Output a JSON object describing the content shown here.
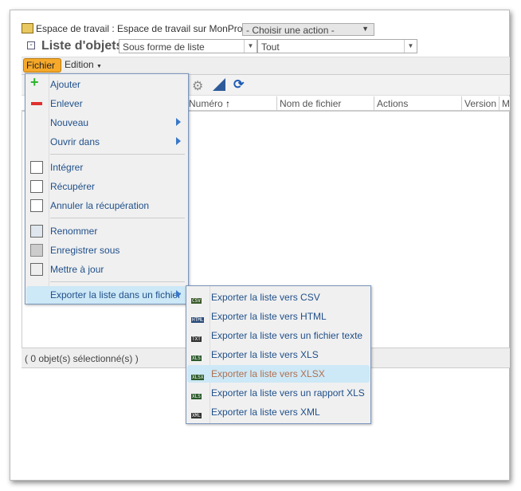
{
  "header": {
    "workspace": "Espace de travail : Espace de travail sur MonProduit",
    "action_select": "- Choisir une action -",
    "title": "Liste d'objets",
    "view_select": "Sous forme de liste",
    "filter_select": "Tout"
  },
  "menubar": {
    "file": "Fichier",
    "edit": "Edition"
  },
  "table": {
    "columns": [
      "Numéro",
      "Nom de fichier",
      "Actions",
      "Version",
      "M"
    ],
    "sort_indicator": "↑"
  },
  "status": "( 0 objet(s) sélectionné(s) )",
  "file_menu": {
    "items": [
      {
        "label": "Ajouter",
        "icon": "add-icon"
      },
      {
        "label": "Enlever",
        "icon": "remove-icon"
      },
      {
        "label": "Nouveau",
        "submenu": true
      },
      {
        "label": "Ouvrir dans",
        "submenu": true
      },
      {
        "label": "Intégrer",
        "icon": "checkin-icon"
      },
      {
        "label": "Récupérer",
        "icon": "checkout-icon"
      },
      {
        "label": "Annuler la récupération",
        "icon": "undo-checkout-icon"
      },
      {
        "label": "Renommer",
        "icon": "rename-icon"
      },
      {
        "label": "Enregistrer sous",
        "icon": "save-as-icon"
      },
      {
        "label": "Mettre à jour",
        "icon": "update-icon"
      },
      {
        "label": "Exporter la liste dans un fichier",
        "submenu": true,
        "highlighted": true
      }
    ]
  },
  "export_menu": {
    "items": [
      {
        "label": "Exporter la liste vers CSV",
        "badge": "CSV"
      },
      {
        "label": "Exporter la liste vers HTML",
        "badge": "HTML"
      },
      {
        "label": "Exporter la liste vers un fichier texte",
        "badge": "TXT"
      },
      {
        "label": "Exporter la liste vers XLS",
        "badge": "XLS"
      },
      {
        "label": "Exporter la liste vers XLSX",
        "badge": "XLSX",
        "highlighted": true
      },
      {
        "label": "Exporter la liste vers un rapport XLS",
        "badge": "XLS"
      },
      {
        "label": "Exporter la liste vers XML",
        "badge": "XML"
      }
    ]
  },
  "colors": {
    "menu_text": "#1f4f8a",
    "highlight": "#cde8f6",
    "hover_text": "#b07050",
    "fichier_button": "#f6a92a"
  }
}
